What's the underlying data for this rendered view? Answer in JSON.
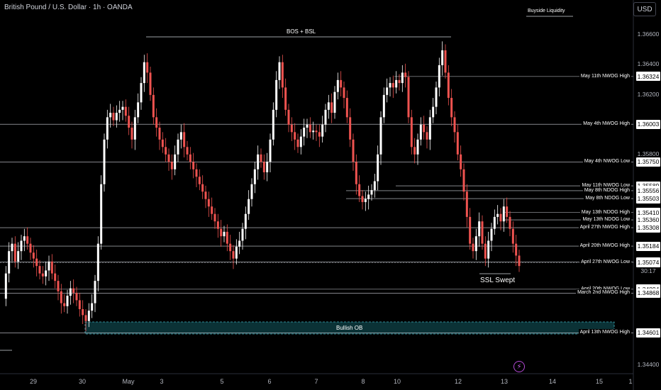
{
  "header": {
    "symbol_title": "British Pound / U.S. Dollar · 1h · OANDA",
    "currency": "USD"
  },
  "colors": {
    "up": "#ffffff",
    "down": "#ef5350",
    "ob_fill": "#0d3b40",
    "ob_border": "#4dd0e1",
    "axis_text": "#b2b5be"
  },
  "annotations": {
    "bos": "BOS + BSL",
    "buyside": "Buyside Liquidity",
    "ssl": "SSL Swept",
    "ob": "Bullish OB"
  },
  "price_ticks": [
    "1.36600",
    "1.36400",
    "1.36200",
    "1.35800",
    "1.34400"
  ],
  "x_ticks": [
    "29",
    "30",
    "May",
    "3",
    "5",
    "6",
    "7",
    "8",
    "10",
    "12",
    "13",
    "14",
    "15",
    "1"
  ],
  "timer": "30:17",
  "levels": [
    {
      "label": "May 11th NWOG High",
      "price": "1.36324"
    },
    {
      "label": "May 4th NWOG High",
      "price": "1.36003"
    },
    {
      "label": "May 4th NWOG Low",
      "price": "1.35750"
    },
    {
      "label": "May 11th NWOG Low",
      "price": "1.35589"
    },
    {
      "label": "May 8th NDOG High",
      "price": "1.35556"
    },
    {
      "label": "May 8th NDOG Low",
      "price": "1.35503"
    },
    {
      "label": "May 13th NDOG High",
      "price": "1.35410"
    },
    {
      "label": "May 13th NDOG Low",
      "price": "1.35360"
    },
    {
      "label": "April 27th NWOG High",
      "price": "1.35308"
    },
    {
      "label": "April 20th NWOG High",
      "price": "1.35184"
    },
    {
      "label": "",
      "price": "1.35076"
    },
    {
      "label": "April 27th NWOG Low",
      "price": "1.35074"
    },
    {
      "label": "April 20th NWOG Low",
      "price": "1.34894"
    },
    {
      "label": "March 2nd NWOG High",
      "price": "1.34868"
    },
    {
      "label": "April 13th NWOG High",
      "price": "1.34601"
    }
  ],
  "chart_data": {
    "type": "candlestick",
    "title": "British Pound / U.S. Dollar · 1h · OANDA",
    "ylim": [
      1.3435,
      1.368
    ],
    "price_path": [
      1.3483,
      1.35,
      1.3515,
      1.352,
      1.3508,
      1.3515,
      1.3522,
      1.3525,
      1.352,
      1.3514,
      1.351,
      1.3505,
      1.35,
      1.3498,
      1.3502,
      1.3508,
      1.35,
      1.3495,
      1.3488,
      1.348,
      1.3478,
      1.3485,
      1.349,
      1.3487,
      1.3482,
      1.3476,
      1.3472,
      1.3468,
      1.3475,
      1.348,
      1.3495,
      1.352,
      1.356,
      1.359,
      1.3605,
      1.3608,
      1.3603,
      1.3608,
      1.361,
      1.3612,
      1.3606,
      1.3598,
      1.359,
      1.3605,
      1.3615,
      1.3628,
      1.3642,
      1.3635,
      1.362,
      1.3605,
      1.3598,
      1.359,
      1.3585,
      1.358,
      1.3575,
      1.357,
      1.358,
      1.359,
      1.3595,
      1.3585,
      1.358,
      1.3575,
      1.357,
      1.3565,
      1.356,
      1.3555,
      1.355,
      1.3545,
      1.354,
      1.3535,
      1.353,
      1.3525,
      1.3528,
      1.352,
      1.3515,
      1.351,
      1.3518,
      1.3522,
      1.353,
      1.354,
      1.355,
      1.356,
      1.357,
      1.358,
      1.3575,
      1.3568,
      1.3575,
      1.359,
      1.361,
      1.363,
      1.3642,
      1.3625,
      1.361,
      1.36,
      1.3595,
      1.359,
      1.3585,
      1.3592,
      1.3598,
      1.36,
      1.3595,
      1.3596,
      1.3595,
      1.3592,
      1.36,
      1.361,
      1.3615,
      1.3608,
      1.3622,
      1.363,
      1.3625,
      1.3618,
      1.3605,
      1.359,
      1.3575,
      1.356,
      1.3552,
      1.3548,
      1.355,
      1.3553,
      1.3556,
      1.3562,
      1.358,
      1.3605,
      1.362,
      1.3625,
      1.3628,
      1.3625,
      1.363,
      1.3628,
      1.3635,
      1.3632,
      1.3605,
      1.3585,
      1.358,
      1.359,
      1.36,
      1.3595,
      1.359,
      1.3605,
      1.3612,
      1.3625,
      1.364,
      1.365,
      1.3635,
      1.3618,
      1.3605,
      1.3595,
      1.358,
      1.357,
      1.3555,
      1.3538,
      1.352,
      1.3515,
      1.3525,
      1.3535,
      1.352,
      1.351,
      1.3522,
      1.353,
      1.3538,
      1.354,
      1.3535,
      1.3545,
      1.3538,
      1.353,
      1.352,
      1.3512,
      1.3505
    ],
    "points": [
      {
        "time": "Apr 29",
        "price": 1.3483
      },
      {
        "time": "Apr 30",
        "price": 1.3476
      },
      {
        "time": "May 1",
        "price": 1.3608
      },
      {
        "time": "May 3",
        "price": 1.359
      },
      {
        "time": "May 5",
        "price": 1.352
      },
      {
        "time": "May 6",
        "price": 1.363
      },
      {
        "time": "May 7",
        "price": 1.3596
      },
      {
        "time": "May 8",
        "price": 1.3553
      },
      {
        "time": "May 10",
        "price": 1.3625
      },
      {
        "time": "May 11",
        "price": 1.365
      },
      {
        "time": "May 12",
        "price": 1.3512
      },
      {
        "time": "May 13",
        "price": 1.3505
      }
    ]
  }
}
